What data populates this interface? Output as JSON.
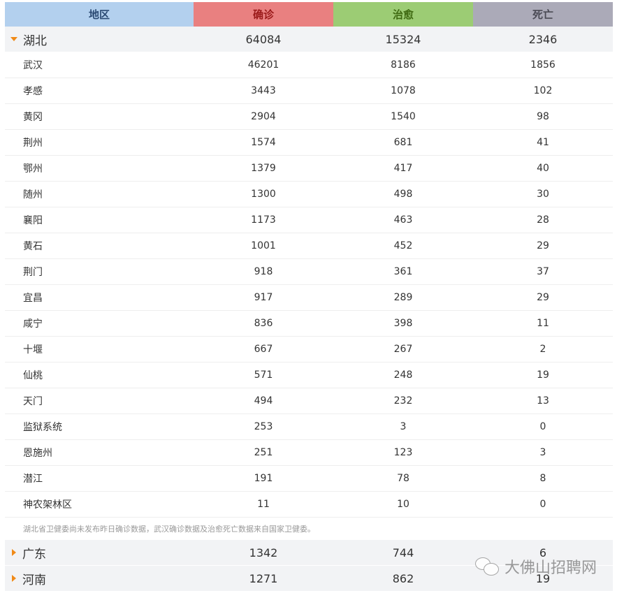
{
  "headers": {
    "region": "地区",
    "confirmed": "确诊",
    "cured": "治愈",
    "dead": "死亡"
  },
  "colors": {
    "region_header": "#b3d0ee",
    "confirmed_header": "#e98080",
    "cured_header": "#9ccc74",
    "dead_header": "#abaab8",
    "expand_arrow": "#f08a18"
  },
  "hubei": {
    "name": "湖北",
    "confirmed": "64084",
    "cured": "15324",
    "dead": "2346",
    "expanded": true,
    "cities": [
      {
        "name": "武汉",
        "confirmed": "46201",
        "cured": "8186",
        "dead": "1856"
      },
      {
        "name": "孝感",
        "confirmed": "3443",
        "cured": "1078",
        "dead": "102"
      },
      {
        "name": "黄冈",
        "confirmed": "2904",
        "cured": "1540",
        "dead": "98"
      },
      {
        "name": "荆州",
        "confirmed": "1574",
        "cured": "681",
        "dead": "41"
      },
      {
        "name": "鄂州",
        "confirmed": "1379",
        "cured": "417",
        "dead": "40"
      },
      {
        "name": "随州",
        "confirmed": "1300",
        "cured": "498",
        "dead": "30"
      },
      {
        "name": "襄阳",
        "confirmed": "1173",
        "cured": "463",
        "dead": "28"
      },
      {
        "name": "黄石",
        "confirmed": "1001",
        "cured": "452",
        "dead": "29"
      },
      {
        "name": "荆门",
        "confirmed": "918",
        "cured": "361",
        "dead": "37"
      },
      {
        "name": "宜昌",
        "confirmed": "917",
        "cured": "289",
        "dead": "29"
      },
      {
        "name": "咸宁",
        "confirmed": "836",
        "cured": "398",
        "dead": "11"
      },
      {
        "name": "十堰",
        "confirmed": "667",
        "cured": "267",
        "dead": "2"
      },
      {
        "name": "仙桃",
        "confirmed": "571",
        "cured": "248",
        "dead": "19"
      },
      {
        "name": "天门",
        "confirmed": "494",
        "cured": "232",
        "dead": "13"
      },
      {
        "name": "监狱系统",
        "confirmed": "253",
        "cured": "3",
        "dead": "0"
      },
      {
        "name": "恩施州",
        "confirmed": "251",
        "cured": "123",
        "dead": "3"
      },
      {
        "name": "潜江",
        "confirmed": "191",
        "cured": "78",
        "dead": "8"
      },
      {
        "name": "神农架林区",
        "confirmed": "11",
        "cured": "10",
        "dead": "0"
      }
    ],
    "note": "湖北省卫健委尚未发布昨日确诊数据，武汉确诊数据及治愈死亡数据来自国家卫健委。"
  },
  "other_provinces": [
    {
      "name": "广东",
      "confirmed": "1342",
      "cured": "744",
      "dead": "6",
      "expanded": false
    },
    {
      "name": "河南",
      "confirmed": "1271",
      "cured": "862",
      "dead": "19",
      "expanded": false
    }
  ],
  "watermark": {
    "icon": "wechat-icon",
    "text": "大佛山招聘网"
  }
}
